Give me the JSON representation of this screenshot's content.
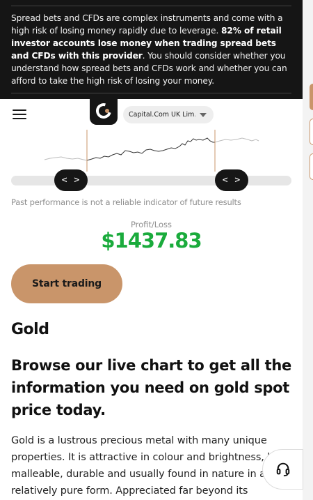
{
  "risk_warning": {
    "part1": "Spread bets and CFDs are complex instruments and come with a high risk of losing money rapidly due to leverage. ",
    "bold": "82% of retail investor accounts lose money when trading spread bets and CFDs with this provider",
    "part2": ". You should consider whether you understand how spread bets and CFDs work and whether you can afford to take the high risk of losing your money."
  },
  "header": {
    "entity_label": "Capital.Com UK Lim..."
  },
  "chart": {
    "left_handle": "< >",
    "right_handle": "< >",
    "disclaimer": "Past performance is not a reliable indicator of future results"
  },
  "profit_loss": {
    "label": "Profit/Loss",
    "value": "$1437.83"
  },
  "cta": {
    "start_trading": "Start trading"
  },
  "content": {
    "title": "Gold",
    "subtitle": "Browse our live chart to get all the information you need on gold spot price today.",
    "body": "Gold is a lustrous precious metal with many unique properties. It is attractive in colour and brightness, highly malleable, durable and usually found in nature in a relatively pure form. Appreciated far beyond its"
  },
  "icons": {
    "menu": "hamburger-menu-icon",
    "logo": "capital-com-logo",
    "support": "headset-icon",
    "dropdown": "caret-down-icon"
  },
  "colors": {
    "accent": "#c9956a",
    "banner_bg": "#151515",
    "profit": "#1aab3c"
  }
}
